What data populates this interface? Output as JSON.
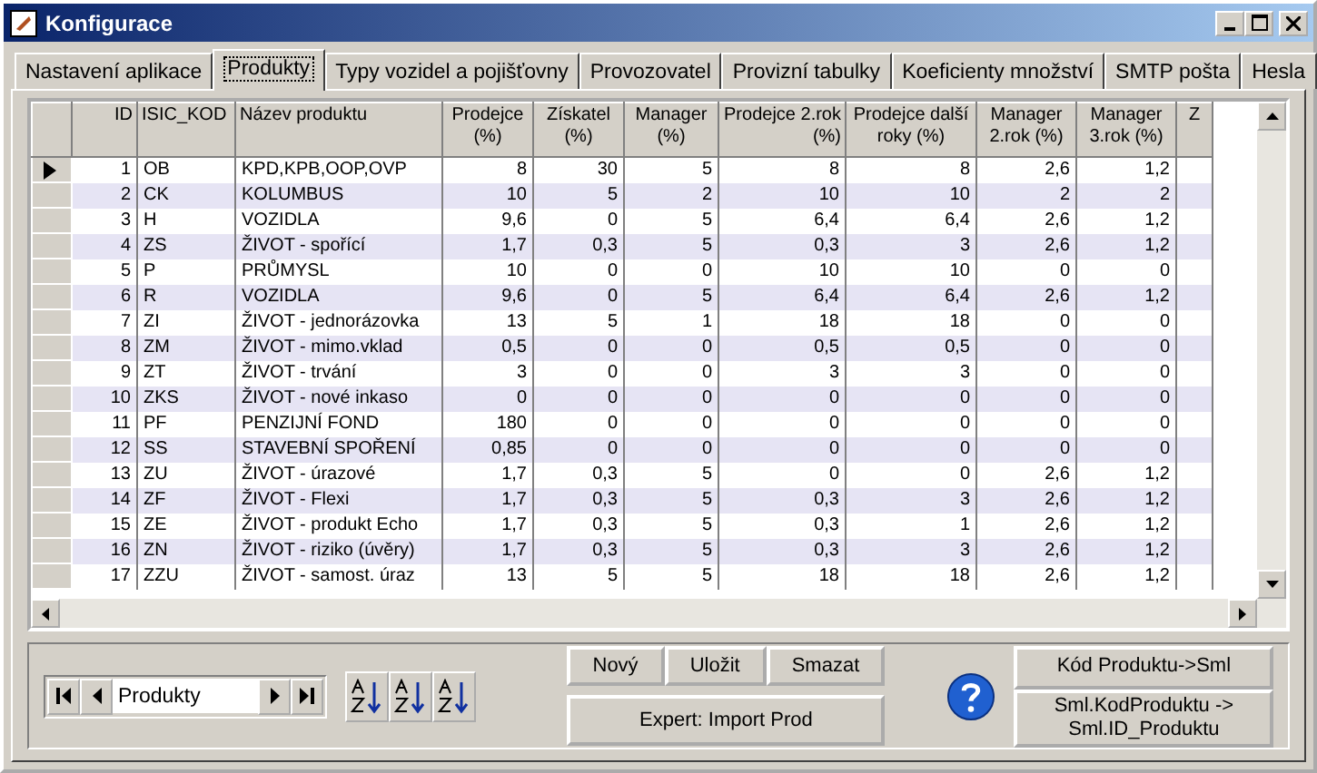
{
  "window": {
    "title": "Konfigurace"
  },
  "tabs": [
    {
      "label": "Nastavení aplikace",
      "selected": false
    },
    {
      "label": "Produkty",
      "selected": true
    },
    {
      "label": "Typy vozidel a pojišťovny",
      "selected": false
    },
    {
      "label": "Provozovatel",
      "selected": false
    },
    {
      "label": "Provizní tabulky",
      "selected": false
    },
    {
      "label": "Koeficienty množství",
      "selected": false
    },
    {
      "label": "SMTP pošta",
      "selected": false
    },
    {
      "label": "Hesla",
      "selected": false
    }
  ],
  "table": {
    "columns": [
      "ID",
      "ISIC_KOD",
      "Název produktu",
      "Prodejce (%)",
      "Získatel (%)",
      "Manager (%)",
      "Prodejce 2.rok (%)",
      "Prodejce další roky (%)",
      "Manager 2.rok (%)",
      "Manager 3.rok (%)",
      "Z"
    ],
    "rows": [
      {
        "current": true,
        "cells": [
          "1",
          "OB",
          "KPD,KPB,OOP,OVP",
          "8",
          "30",
          "5",
          "8",
          "8",
          "2,6",
          "1,2"
        ]
      },
      {
        "current": false,
        "cells": [
          "2",
          "CK",
          "KOLUMBUS",
          "10",
          "5",
          "2",
          "10",
          "10",
          "2",
          "2"
        ]
      },
      {
        "current": false,
        "cells": [
          "3",
          "H",
          "VOZIDLA",
          "9,6",
          "0",
          "5",
          "6,4",
          "6,4",
          "2,6",
          "1,2"
        ]
      },
      {
        "current": false,
        "cells": [
          "4",
          "ZS",
          "ŽIVOT - spořící",
          "1,7",
          "0,3",
          "5",
          "0,3",
          "3",
          "2,6",
          "1,2"
        ]
      },
      {
        "current": false,
        "cells": [
          "5",
          "P",
          "PRŮMYSL",
          "10",
          "0",
          "0",
          "10",
          "10",
          "0",
          "0"
        ]
      },
      {
        "current": false,
        "cells": [
          "6",
          "R",
          "VOZIDLA",
          "9,6",
          "0",
          "5",
          "6,4",
          "6,4",
          "2,6",
          "1,2"
        ]
      },
      {
        "current": false,
        "cells": [
          "7",
          "ZI",
          "ŽIVOT - jednorázovka",
          "13",
          "5",
          "1",
          "18",
          "18",
          "0",
          "0"
        ]
      },
      {
        "current": false,
        "cells": [
          "8",
          "ZM",
          "ŽIVOT - mimo.vklad",
          "0,5",
          "0",
          "0",
          "0,5",
          "0,5",
          "0",
          "0"
        ]
      },
      {
        "current": false,
        "cells": [
          "9",
          "ZT",
          "ŽIVOT - trvání",
          "3",
          "0",
          "0",
          "3",
          "3",
          "0",
          "0"
        ]
      },
      {
        "current": false,
        "cells": [
          "10",
          "ZKS",
          "ŽIVOT - nové inkaso",
          "0",
          "0",
          "0",
          "0",
          "0",
          "0",
          "0"
        ]
      },
      {
        "current": false,
        "cells": [
          "11",
          "PF",
          "PENZIJNÍ FOND",
          "180",
          "0",
          "0",
          "0",
          "0",
          "0",
          "0"
        ]
      },
      {
        "current": false,
        "cells": [
          "12",
          "SS",
          "STAVEBNÍ SPOŘENÍ",
          "0,85",
          "0",
          "0",
          "0",
          "0",
          "0",
          "0"
        ]
      },
      {
        "current": false,
        "cells": [
          "13",
          "ZU",
          "ŽIVOT - úrazové",
          "1,7",
          "0,3",
          "5",
          "0",
          "0",
          "2,6",
          "1,2"
        ]
      },
      {
        "current": false,
        "cells": [
          "14",
          "ZF",
          "ŽIVOT - Flexi",
          "1,7",
          "0,3",
          "5",
          "0,3",
          "3",
          "2,6",
          "1,2"
        ]
      },
      {
        "current": false,
        "cells": [
          "15",
          "ZE",
          "ŽIVOT - produkt Echo",
          "1,7",
          "0,3",
          "5",
          "0,3",
          "1",
          "2,6",
          "1,2"
        ]
      },
      {
        "current": false,
        "cells": [
          "16",
          "ZN",
          "ŽIVOT - riziko (úvěry)",
          "1,7",
          "0,3",
          "5",
          "0,3",
          "3",
          "2,6",
          "1,2"
        ]
      },
      {
        "current": false,
        "cells": [
          "17",
          "ZZU",
          "ŽIVOT - samost. úraz",
          "13",
          "5",
          "5",
          "18",
          "18",
          "2,6",
          "1,2"
        ]
      }
    ]
  },
  "navigator": {
    "value": "Produkty"
  },
  "buttons": {
    "new": "Nový",
    "save": "Uložit",
    "delete": "Smazat",
    "import": "Expert: Import Prod",
    "code_to_sml": "Kód Produktu->Sml",
    "sml_code_to_id": "Sml.KodProduktu -> Sml.ID_Produktu"
  }
}
